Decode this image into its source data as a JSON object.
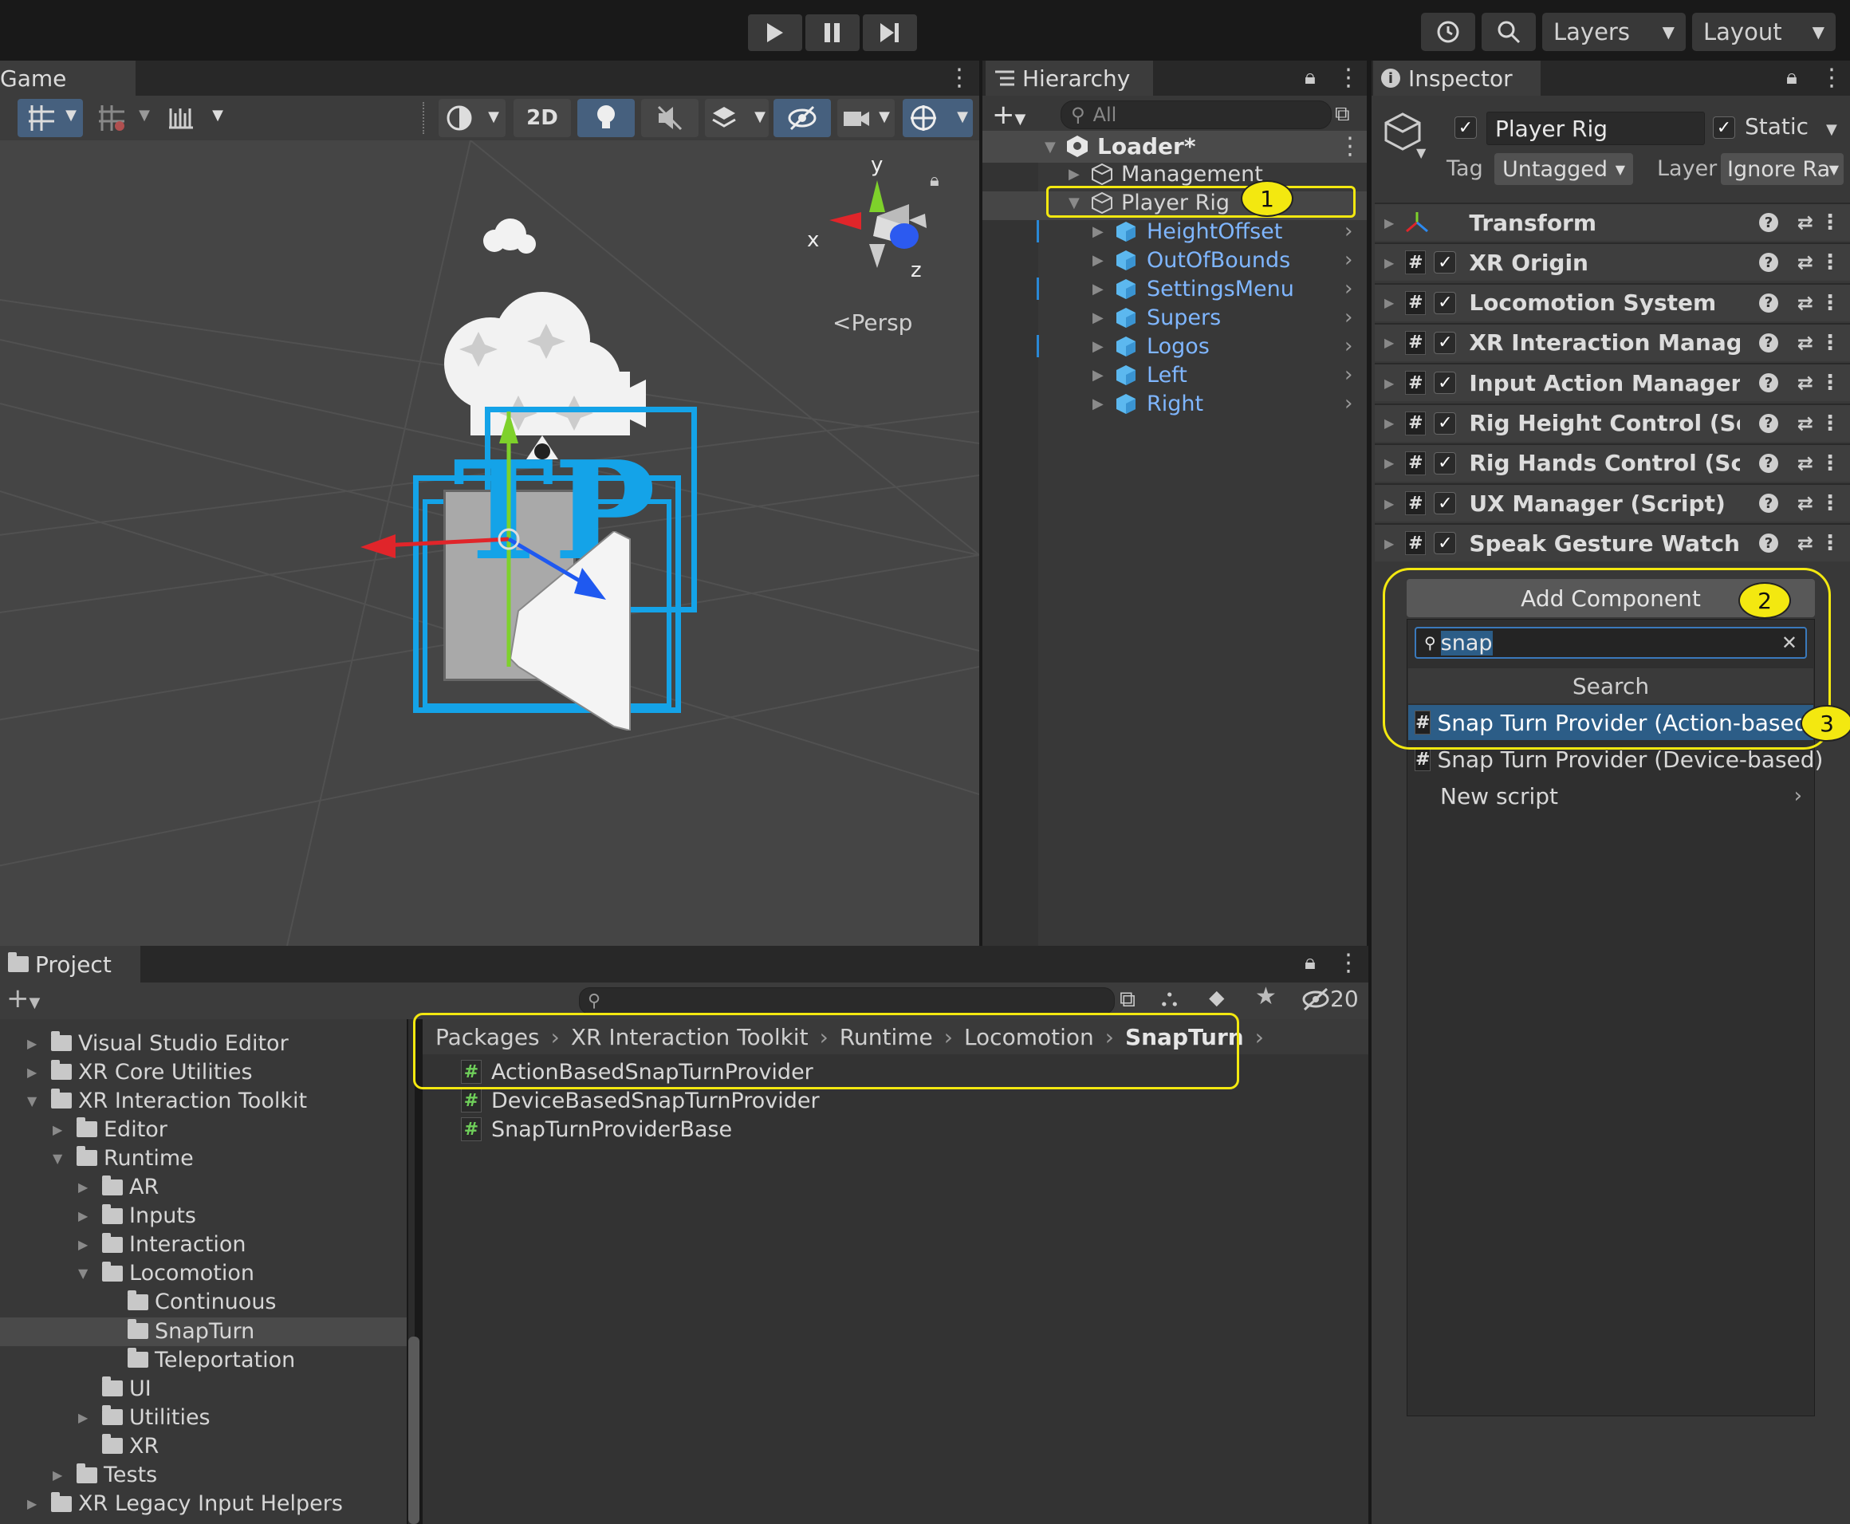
{
  "toolbar": {
    "layers_label": "Layers",
    "layout_label": "Layout"
  },
  "game": {
    "tab_label": "Game",
    "mode_2d": "2D",
    "persp_label": "Persp",
    "axis_x": "x",
    "axis_y": "y",
    "axis_z": "z"
  },
  "hierarchy": {
    "tab_label": "Hierarchy",
    "search_placeholder": "All",
    "scene": "Loader*",
    "items": [
      "Management",
      "Player Rig"
    ],
    "children": [
      "HeightOffset",
      "OutOfBounds",
      "SettingsMenu",
      "Supers",
      "Logos",
      "Left",
      "Right"
    ]
  },
  "inspector": {
    "tab_label": "Inspector",
    "object_name": "Player Rig",
    "static_label": "Static",
    "tag_label": "Tag",
    "tag_value": "Untagged",
    "layer_label": "Layer",
    "layer_value": "Ignore Ra",
    "components": [
      "Transform",
      "XR Origin",
      "Locomotion System",
      "XR Interaction Manager",
      "Input Action Manager",
      "Rig Height Control (Scrip",
      "Rig Hands Control (Scrip",
      "UX Manager (Script)",
      "Speak Gesture Watcher"
    ],
    "add_component_label": "Add Component",
    "search_value": "snap",
    "search_header": "Search",
    "results": [
      "Snap Turn Provider (Action-based)",
      "Snap Turn Provider (Device-based)"
    ],
    "new_script": "New script"
  },
  "project": {
    "tab_label": "Project",
    "hidden_count": "20",
    "tree": [
      "Visual Studio Editor",
      "XR Core Utilities",
      "XR Interaction Toolkit",
      "Editor",
      "Runtime",
      "AR",
      "Inputs",
      "Interaction",
      "Locomotion",
      "Continuous",
      "SnapTurn",
      "Teleportation",
      "UI",
      "Utilities",
      "XR",
      "Tests",
      "XR Legacy Input Helpers"
    ],
    "breadcrumb": [
      "Packages",
      "XR Interaction Toolkit",
      "Runtime",
      "Locomotion",
      "SnapTurn"
    ],
    "files": [
      "ActionBasedSnapTurnProvider",
      "DeviceBasedSnapTurnProvider",
      "SnapTurnProviderBase"
    ]
  },
  "callouts": [
    "1",
    "2",
    "3"
  ],
  "colors": {
    "highlight": "#f3e810",
    "selection": "#2c5d87",
    "hierarchy_child_text": "#7fb6ff"
  }
}
